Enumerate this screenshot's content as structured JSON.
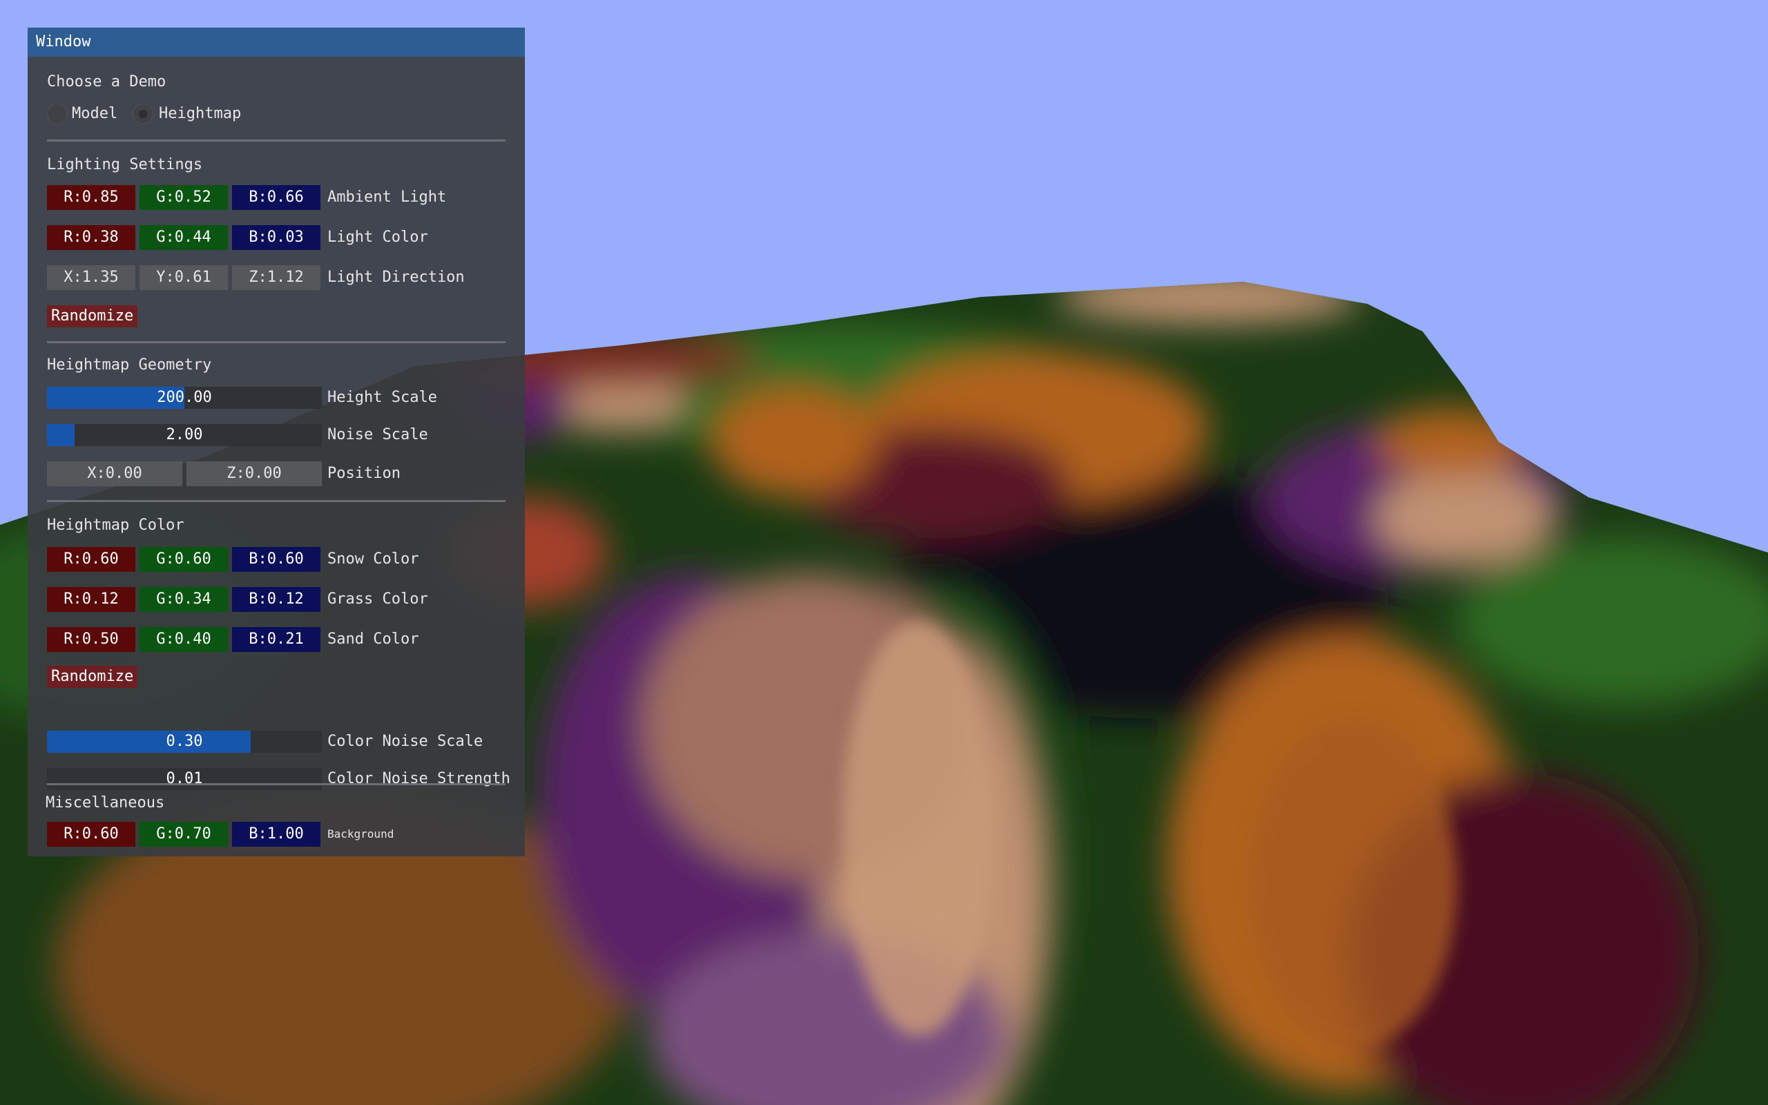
{
  "window": {
    "title": "Window"
  },
  "demo": {
    "heading": "Choose a Demo",
    "options": [
      {
        "label": "Model",
        "selected": false
      },
      {
        "label": "Heightmap",
        "selected": true
      }
    ]
  },
  "lighting": {
    "heading": "Lighting Settings",
    "ambient": {
      "r": "R:0.85",
      "g": "G:0.52",
      "b": "B:0.66",
      "label": "Ambient Light"
    },
    "light_color": {
      "r": "R:0.38",
      "g": "G:0.44",
      "b": "B:0.03",
      "label": "Light Color"
    },
    "light_direction": {
      "x": "X:1.35",
      "y": "Y:0.61",
      "z": "Z:1.12",
      "label": "Light Direction"
    },
    "randomize_label": "Randomize"
  },
  "geometry": {
    "heading": "Heightmap Geometry",
    "height_scale": {
      "value": "200.00",
      "fraction": 0.5,
      "label": "Height Scale"
    },
    "noise_scale": {
      "value": "2.00",
      "fraction": 0.1,
      "label": "Noise Scale"
    },
    "position": {
      "x": "X:0.00",
      "z": "Z:0.00",
      "label": "Position"
    }
  },
  "color": {
    "heading": "Heightmap Color",
    "snow": {
      "r": "R:0.60",
      "g": "G:0.60",
      "b": "B:0.60",
      "label": "Snow Color"
    },
    "grass": {
      "r": "R:0.12",
      "g": "G:0.34",
      "b": "B:0.12",
      "label": "Grass Color"
    },
    "sand": {
      "r": "R:0.50",
      "g": "G:0.40",
      "b": "B:0.21",
      "label": "Sand Color"
    },
    "randomize_label": "Randomize",
    "noise_scale": {
      "value": "0.30",
      "fraction": 0.74,
      "label": "Color Noise Scale"
    },
    "noise_strength": {
      "value": "0.01",
      "fraction": 0.0,
      "label": "Color Noise Strength"
    }
  },
  "misc": {
    "heading": "Miscellaneous",
    "background": {
      "r": "R:0.60",
      "g": "G:0.70",
      "b": "B:1.00",
      "label": "Background"
    }
  },
  "colors": {
    "sky": "#98aefd",
    "titlebar": "#2d5d92",
    "slider_fill": "#1657ad",
    "button": "#6e1f21",
    "chip_red": "#5a0808",
    "chip_green": "#0b5512",
    "chip_blue": "#0b0f5a",
    "terrain_grass": "#2a5a1e",
    "terrain_sand": "#9a5a1e",
    "terrain_snow": "#c8987a",
    "terrain_purple": "#5a2468",
    "terrain_maroon": "#4a1020"
  }
}
